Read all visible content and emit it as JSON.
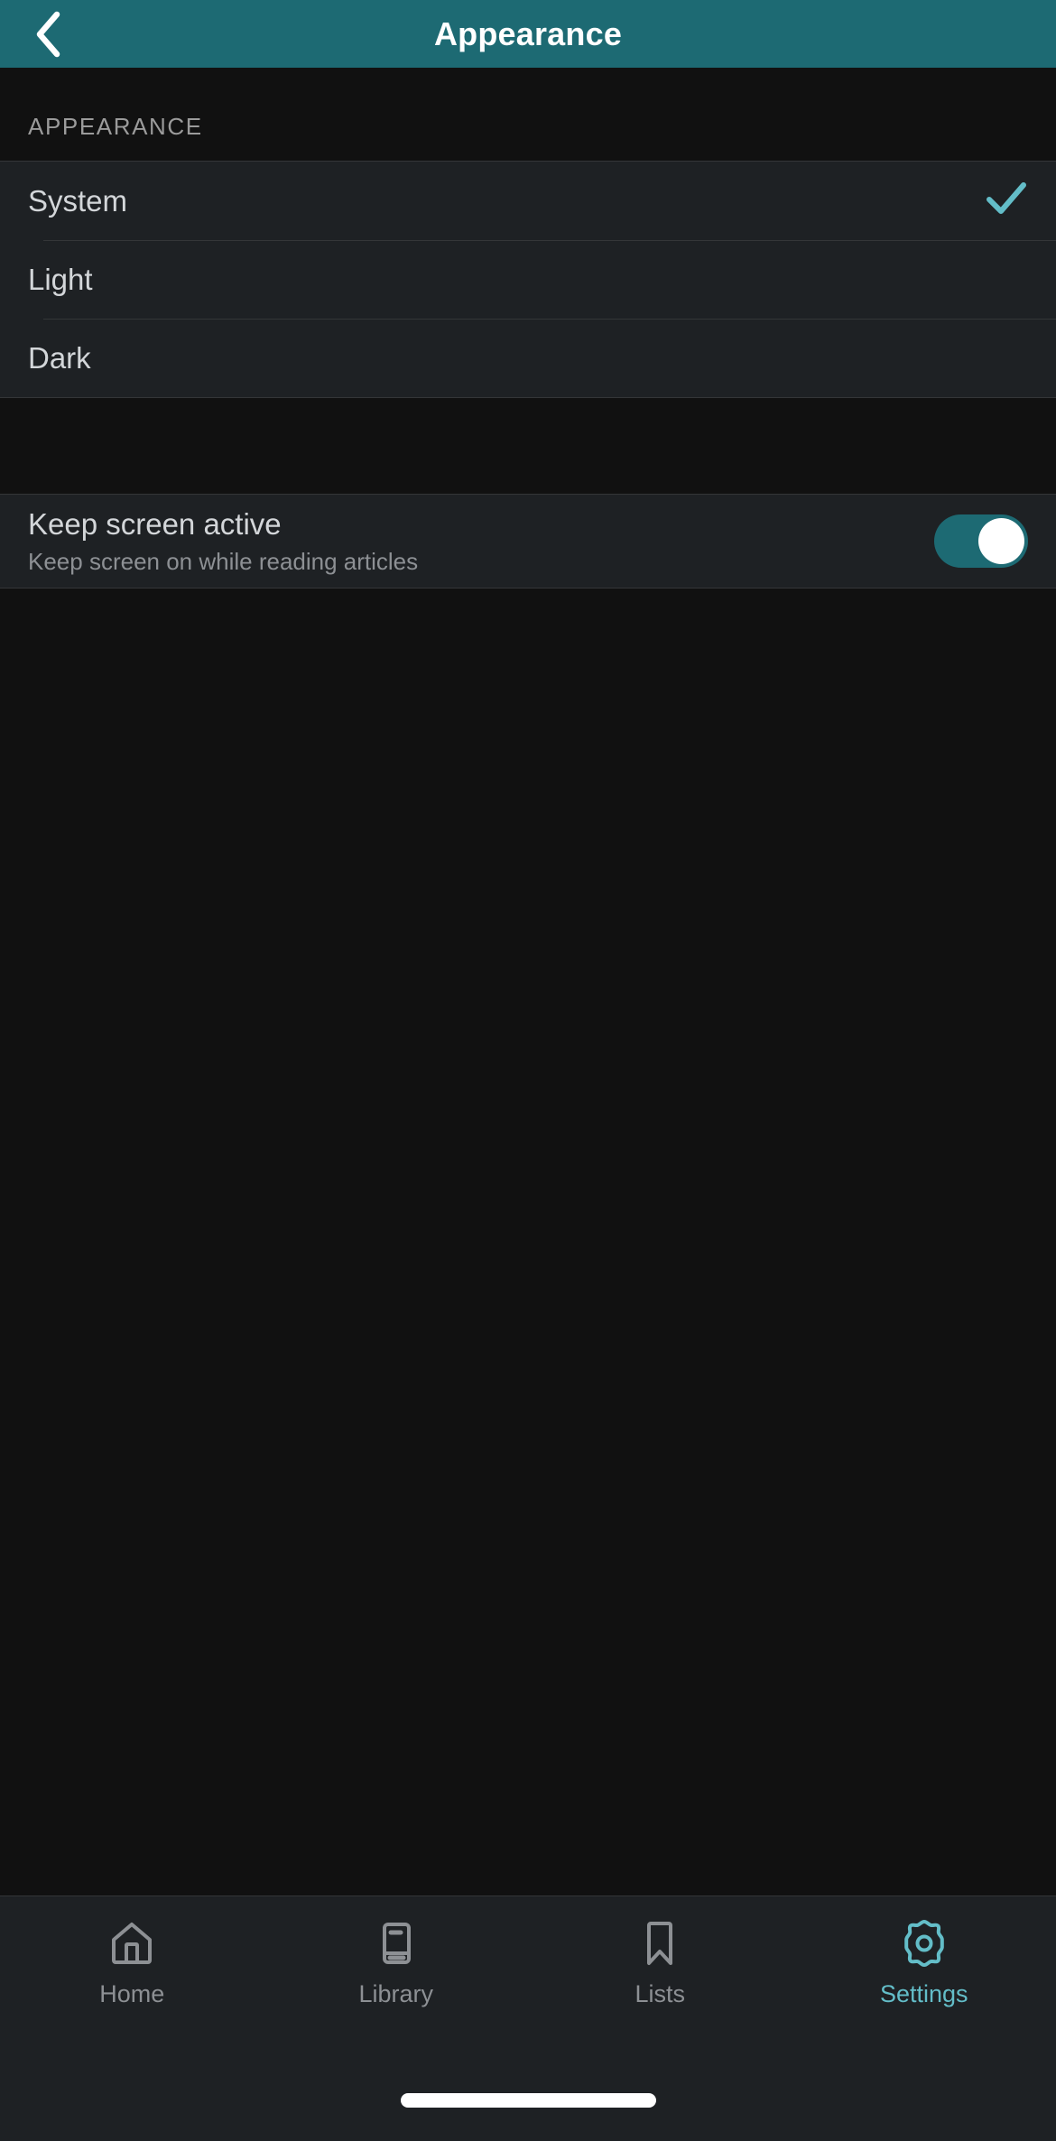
{
  "header": {
    "title": "Appearance",
    "back_icon": "chevron-left-icon",
    "background_color": "#1d6a73",
    "title_color": "#ffffff"
  },
  "appearance_section": {
    "label": "APPEARANCE",
    "selected": "System",
    "check_icon": "check-icon",
    "check_color": "#63bdc8",
    "options": [
      {
        "label": "System",
        "checked": true
      },
      {
        "label": "Light",
        "checked": false
      },
      {
        "label": "Dark",
        "checked": false
      }
    ]
  },
  "keep_screen": {
    "title": "Keep screen active",
    "subtitle": "Keep screen on while reading articles",
    "toggle_on": true,
    "toggle_color": "#1d6a73",
    "knob_color": "#ffffff"
  },
  "bottom_nav": {
    "active": "Settings",
    "active_color": "#63bdc8",
    "inactive_color": "#8d9094",
    "items": [
      {
        "label": "Home",
        "icon": "home-icon",
        "active": false
      },
      {
        "label": "Library",
        "icon": "book-icon",
        "active": false
      },
      {
        "label": "Lists",
        "icon": "bookmark-icon",
        "active": false
      },
      {
        "label": "Settings",
        "icon": "gear-icon",
        "active": true
      }
    ]
  }
}
